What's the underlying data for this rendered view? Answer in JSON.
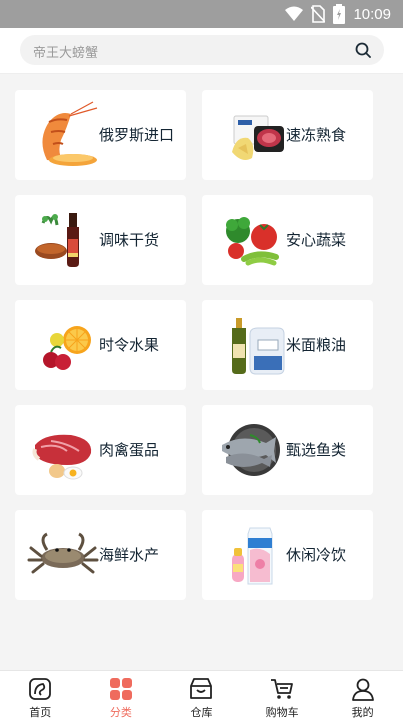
{
  "status_bar": {
    "time": "10:09"
  },
  "search": {
    "placeholder": "帝王大螃蟹"
  },
  "categories": [
    {
      "label": "俄罗斯进口",
      "icon": "shrimp-icon"
    },
    {
      "label": "速冻熟食",
      "icon": "frozen-food-icon"
    },
    {
      "label": "调味干货",
      "icon": "seasoning-icon"
    },
    {
      "label": "安心蔬菜",
      "icon": "vegetable-icon"
    },
    {
      "label": "时令水果",
      "icon": "fruit-icon"
    },
    {
      "label": "米面粮油",
      "icon": "grain-oil-icon"
    },
    {
      "label": "肉禽蛋品",
      "icon": "meat-egg-icon"
    },
    {
      "label": "甄选鱼类",
      "icon": "fish-icon"
    },
    {
      "label": "海鲜水产",
      "icon": "crab-icon"
    },
    {
      "label": "休闲冷饮",
      "icon": "drink-icon"
    }
  ],
  "tabbar": {
    "items": [
      {
        "label": "首页",
        "icon": "home-icon"
      },
      {
        "label": "分类",
        "icon": "category-icon",
        "active": true
      },
      {
        "label": "仓库",
        "icon": "warehouse-icon"
      },
      {
        "label": "购物车",
        "icon": "cart-icon"
      },
      {
        "label": "我的",
        "icon": "profile-icon"
      }
    ]
  },
  "colors": {
    "accent": "#ef6b5d",
    "statusbar": "#9e9e9e",
    "background": "#f4f4f4"
  }
}
